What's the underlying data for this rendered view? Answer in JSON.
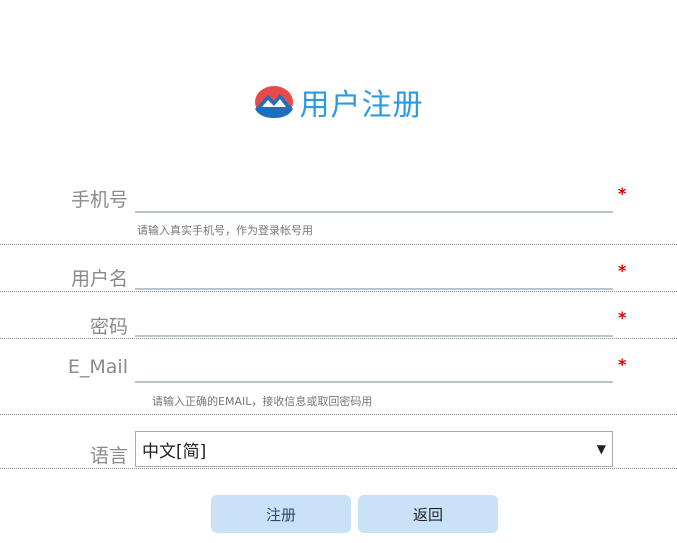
{
  "header": {
    "title": "用户注册"
  },
  "form": {
    "phone": {
      "label": "手机号",
      "value": "",
      "required_mark": "*",
      "hint": "请输入真实手机号，作为登录帐号用"
    },
    "username": {
      "label": "用户名",
      "value": "",
      "required_mark": "*"
    },
    "password": {
      "label": "密码",
      "value": "",
      "required_mark": "*"
    },
    "email": {
      "label": "E_Mail",
      "value": "",
      "required_mark": "*",
      "hint": "请输入正确的EMAIL，接收信息或取回密码用"
    },
    "language": {
      "label": "语言",
      "selected": "中文[简]",
      "arrow": "▼"
    }
  },
  "buttons": {
    "register": "注册",
    "back": "返回"
  },
  "colors": {
    "title": "#2e9be0",
    "required": "#e00000",
    "button_bg": "#c9e2f8"
  },
  "icons": {
    "logo": "mountain-logo-icon",
    "dropdown": "chevron-down-icon"
  }
}
